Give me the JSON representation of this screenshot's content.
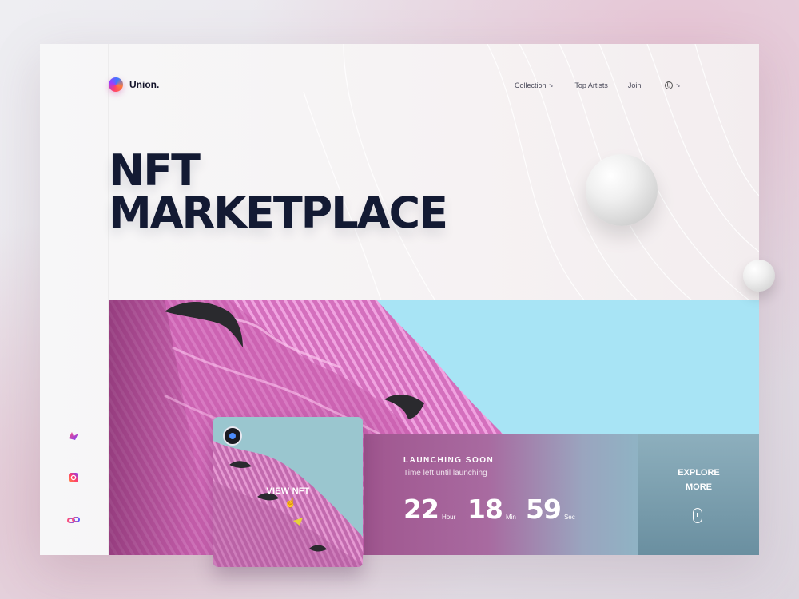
{
  "brand": {
    "name": "Union.",
    "logo_icon": "gradient-orb-icon"
  },
  "nav": {
    "items": [
      {
        "label": "Collection",
        "has_dropdown": true
      },
      {
        "label": "Top Artists",
        "has_dropdown": false
      },
      {
        "label": "Join",
        "has_dropdown": false
      }
    ],
    "language_icon": "globe-icon"
  },
  "hero": {
    "title_line1": "NFT",
    "title_line2": "MARKETPLACE"
  },
  "social": [
    {
      "icon": "bird-icon"
    },
    {
      "icon": "instagram-icon"
    },
    {
      "icon": "chain-icon"
    }
  ],
  "nft_card": {
    "cta": "VIEW NFT",
    "badge_icon": "avatar-badge-icon",
    "cursor_icon": "pointer-hand-icon"
  },
  "countdown": {
    "title": "LAUNCHING SOON",
    "subtitle": "Time left until launching",
    "hours": "22",
    "hours_label": "Hour",
    "minutes": "18",
    "minutes_label": "Min",
    "seconds": "59",
    "seconds_label": "Sec"
  },
  "explore": {
    "label": "EXPLORE\nMORE",
    "icon": "scroll-mouse-icon"
  },
  "colors": {
    "title": "#131a33",
    "pink": "#d87ac4",
    "sky": "#a8e4f5",
    "countdown_start": "#a0568f",
    "explore": "#7a9eaf"
  }
}
